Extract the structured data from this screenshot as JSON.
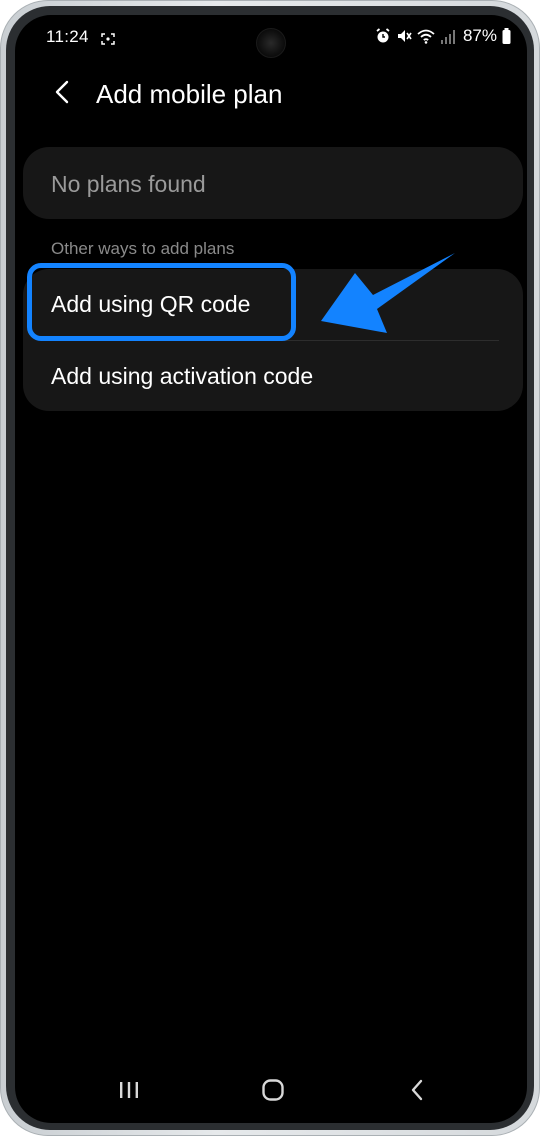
{
  "status_bar": {
    "time": "11:24",
    "battery_percent": "87%"
  },
  "header": {
    "title": "Add mobile plan"
  },
  "plans": {
    "empty_text": "No plans found"
  },
  "other_ways": {
    "section_label": "Other ways to add plans",
    "options": [
      {
        "label": "Add using QR code"
      },
      {
        "label": "Add using activation code"
      }
    ]
  },
  "annotation": {
    "highlight_color": "#1383ff",
    "highlighted_option": "Add using QR code"
  },
  "icons": {
    "back": "chevron-left-icon",
    "screenshot": "screenshot-icon",
    "alarm": "alarm-icon",
    "mute": "mute-icon",
    "wifi": "wifi-icon",
    "signal": "signal-icon",
    "battery": "battery-icon",
    "nav_recent": "recent-apps-icon",
    "nav_home": "home-icon",
    "nav_back": "nav-back-icon"
  }
}
